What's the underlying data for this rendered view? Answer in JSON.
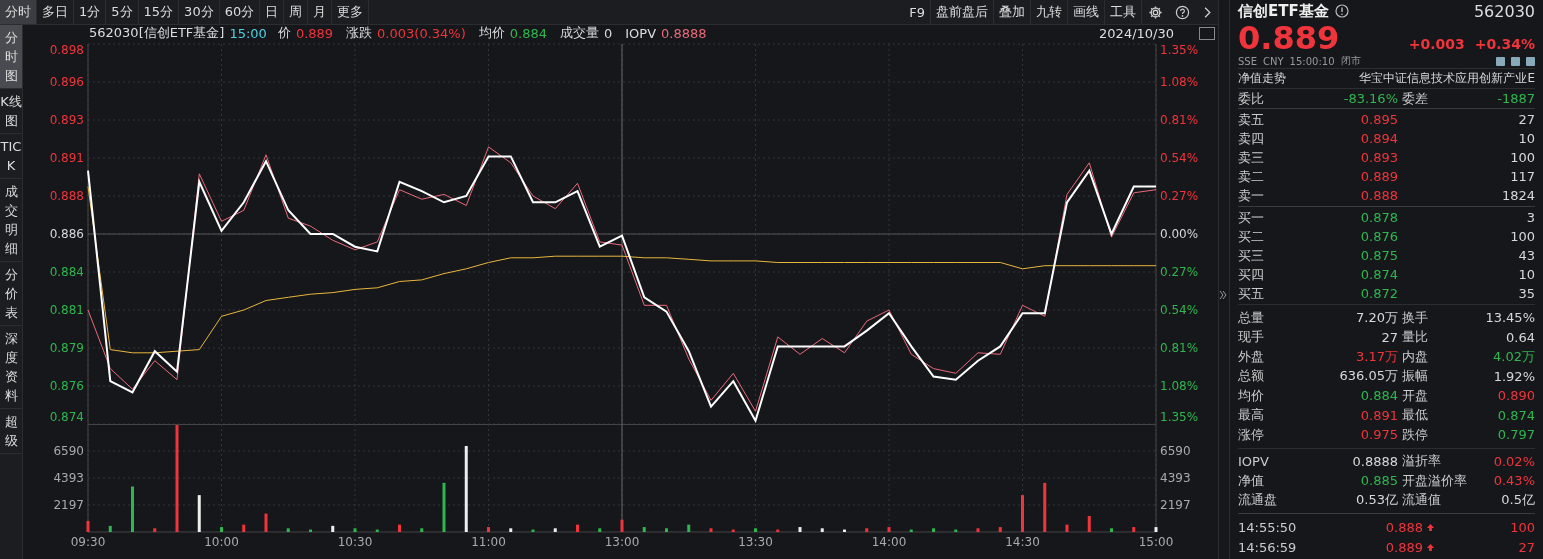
{
  "toolbar": {
    "periods": [
      {
        "label": "分时",
        "selected": true
      },
      {
        "label": "多日",
        "selected": false
      },
      {
        "label": "1分",
        "selected": false
      },
      {
        "label": "5分",
        "selected": false
      },
      {
        "label": "15分",
        "selected": false
      },
      {
        "label": "30分",
        "selected": false
      },
      {
        "label": "60分",
        "selected": false
      },
      {
        "label": "日",
        "selected": false
      },
      {
        "label": "周",
        "selected": false
      },
      {
        "label": "月",
        "selected": false
      },
      {
        "label": "更多",
        "selected": false
      }
    ],
    "tools": [
      "F9",
      "盘前盘后",
      "叠加",
      "九转",
      "画线",
      "工具"
    ]
  },
  "side_tabs": [
    {
      "label": "分时图",
      "selected": true
    },
    {
      "label": "K线图",
      "selected": false
    },
    {
      "label": "TICK",
      "selected": false
    },
    {
      "label": "成交明细",
      "selected": false
    },
    {
      "label": "分价表",
      "selected": false
    },
    {
      "label": "深度资料",
      "selected": false
    },
    {
      "label": "超级",
      "selected": false
    }
  ],
  "chart_header": {
    "code_name": "562030[信创ETF基金]",
    "time": "15:00",
    "fields": [
      {
        "label": "价",
        "value": "0.889",
        "color": "#f0343b"
      },
      {
        "label": "涨跌",
        "value": "0.003(0.34%)",
        "color": "#f0343b"
      },
      {
        "label": "均价",
        "value": "0.884",
        "color": "#2fb64f"
      },
      {
        "label": "成交量",
        "value": "0",
        "color": "#d8d8d8"
      },
      {
        "label": "IOPV",
        "value": "0.8888",
        "color": "#e86a7a"
      }
    ],
    "date": "2024/10/30"
  },
  "price_chart": {
    "chart_data": {
      "type": "line",
      "categories": [
        null,
        null,
        null,
        null,
        null,
        null,
        null,
        null,
        null,
        null,
        null,
        null,
        null,
        null,
        null,
        null,
        null,
        null,
        null,
        null,
        null,
        null,
        null,
        null,
        null,
        null,
        null,
        null,
        null,
        null,
        null,
        null,
        null,
        null,
        null,
        null,
        null,
        null,
        null,
        null,
        null,
        null,
        null,
        null,
        null,
        null,
        null,
        null,
        null
      ],
      "series": [
        {
          "color": "#ffffff",
          "values": [
            0.89,
            0.8767,
            0.876,
            0.8786,
            0.8773,
            0.8893,
            0.8862,
            0.888,
            0.8906,
            0.8875,
            0.886,
            0.886,
            0.8852,
            0.8849,
            0.8893,
            0.8887,
            0.888,
            0.8884,
            0.8909,
            0.8909,
            0.888,
            0.888,
            0.8887,
            0.8852,
            0.8859,
            0.882,
            0.8811,
            0.8786,
            0.8751,
            0.8767,
            0.8742,
            0.8789,
            0.8789,
            0.8789,
            0.8789,
            0.8799,
            0.881,
            0.8789,
            0.877,
            0.8768,
            0.878,
            0.8789,
            0.881,
            0.881,
            0.888,
            0.89,
            0.886,
            0.889,
            0.889
          ]
        },
        {
          "color": "#e8b63c",
          "values": [
            0.889,
            0.8787,
            0.8785,
            0.8785,
            0.8786,
            0.8787,
            0.8808,
            0.8812,
            0.8818,
            0.882,
            0.8822,
            0.8823,
            0.8825,
            0.8826,
            0.883,
            0.8831,
            0.8835,
            0.8838,
            0.8842,
            0.8845,
            0.8845,
            0.8846,
            0.8846,
            0.8846,
            0.8846,
            0.8845,
            0.8845,
            0.8844,
            0.8843,
            0.8843,
            0.8843,
            0.8842,
            0.8842,
            0.8842,
            0.8842,
            0.8842,
            0.8842,
            0.8842,
            0.8842,
            0.8842,
            0.8842,
            0.8842,
            0.8838,
            0.884,
            0.884,
            0.884,
            0.884,
            0.884,
            0.884
          ]
        },
        {
          "color": "#e86a7a",
          "values": [
            0.8812,
            0.8775,
            0.8762,
            0.878,
            0.8768,
            0.8898,
            0.8868,
            0.8875,
            0.891,
            0.887,
            0.8865,
            0.8856,
            0.885,
            0.8855,
            0.8888,
            0.8882,
            0.8885,
            0.8878,
            0.8915,
            0.8905,
            0.8884,
            0.8876,
            0.8892,
            0.8855,
            0.8853,
            0.8815,
            0.8815,
            0.8781,
            0.8755,
            0.8772,
            0.8748,
            0.8795,
            0.8784,
            0.8794,
            0.8785,
            0.8805,
            0.8812,
            0.8784,
            0.8775,
            0.8772,
            0.8785,
            0.8784,
            0.8815,
            0.8808,
            0.8885,
            0.8905,
            0.8858,
            0.8886,
            0.8888
          ]
        }
      ],
      "ylim": [
        0.874,
        0.898
      ],
      "yticks": [
        {
          "value": 0.898,
          "label": "0.898"
        },
        {
          "value": 0.8956,
          "label": "0.896"
        },
        {
          "value": 0.8932,
          "label": "0.893"
        },
        {
          "value": 0.8908,
          "label": "0.891"
        },
        {
          "value": 0.8884,
          "label": "0.888"
        },
        {
          "value": 0.886,
          "label": "0.886"
        },
        {
          "value": 0.8836,
          "label": "0.884"
        },
        {
          "value": 0.8812,
          "label": "0.881"
        },
        {
          "value": 0.8788,
          "label": "0.879"
        },
        {
          "value": 0.8764,
          "label": "0.876"
        },
        {
          "value": 0.874,
          "label": "0.874"
        }
      ],
      "grid": true,
      "ref_lines": [
        {
          "axis": "y",
          "value": 0.886
        }
      ]
    },
    "percent_ticks": [
      {
        "label": "1.35%",
        "color": "#f0343b"
      },
      {
        "label": "1.08%",
        "color": "#f0343b"
      },
      {
        "label": "0.81%",
        "color": "#f0343b"
      },
      {
        "label": "0.54%",
        "color": "#f0343b"
      },
      {
        "label": "0.27%",
        "color": "#f0343b"
      },
      {
        "label": "0.00%",
        "color": "#d8d8d8"
      },
      {
        "label": "0.27%",
        "color": "#2fb64f"
      },
      {
        "label": "0.54%",
        "color": "#2fb64f"
      },
      {
        "label": "0.81%",
        "color": "#2fb64f"
      },
      {
        "label": "1.08%",
        "color": "#2fb64f"
      },
      {
        "label": "1.35%",
        "color": "#2fb64f"
      }
    ]
  },
  "volume_chart": {
    "chart_data": {
      "type": "bar",
      "stacked": true,
      "categories": [
        "09:30",
        null,
        null,
        null,
        null,
        null,
        "10:00",
        null,
        null,
        null,
        null,
        null,
        "10:30",
        null,
        null,
        null,
        null,
        null,
        "11:00",
        null,
        null,
        null,
        null,
        null,
        "13:00",
        null,
        null,
        null,
        null,
        null,
        "13:30",
        null,
        null,
        null,
        null,
        null,
        "14:00",
        null,
        null,
        null,
        null,
        null,
        "14:30",
        null,
        null,
        null,
        null,
        null,
        "15:00"
      ],
      "series": [
        {
          "color": "#f0343b",
          "values": [
            900,
            null,
            null,
            300,
            8700,
            null,
            null,
            600,
            1500,
            null,
            null,
            null,
            null,
            null,
            600,
            null,
            null,
            null,
            400,
            null,
            null,
            null,
            600,
            null,
            1000,
            null,
            null,
            null,
            300,
            200,
            null,
            200,
            null,
            null,
            null,
            300,
            400,
            null,
            null,
            null,
            300,
            400,
            3000,
            4000,
            600,
            1300,
            null,
            400,
            null
          ]
        },
        {
          "color": "#2fb64f",
          "values": [
            null,
            500,
            3700,
            null,
            null,
            null,
            400,
            null,
            null,
            300,
            200,
            null,
            300,
            200,
            null,
            300,
            4000,
            null,
            null,
            null,
            200,
            null,
            null,
            300,
            null,
            400,
            300,
            600,
            null,
            null,
            300,
            null,
            null,
            null,
            null,
            null,
            null,
            200,
            300,
            200,
            null,
            null,
            null,
            null,
            null,
            null,
            300,
            null,
            null
          ]
        },
        {
          "color": "#eeeeee",
          "values": [
            null,
            null,
            null,
            null,
            null,
            3000,
            null,
            null,
            null,
            null,
            null,
            500,
            null,
            null,
            null,
            null,
            null,
            7000,
            null,
            300,
            null,
            300,
            null,
            null,
            null,
            null,
            null,
            null,
            null,
            null,
            null,
            null,
            400,
            300,
            200,
            null,
            null,
            null,
            null,
            null,
            null,
            null,
            null,
            null,
            null,
            null,
            null,
            null,
            400
          ]
        }
      ],
      "ylim": [
        0,
        8787
      ],
      "yticks": [
        2197,
        4393,
        6590
      ],
      "grid": true
    },
    "right_axis_labels": [
      "6590",
      "4393",
      "2197"
    ]
  },
  "quote": {
    "name": "信创ETF基金",
    "code": "562030",
    "price": "0.889",
    "change": "+0.003",
    "change_pct": "+0.34%",
    "color": "#f0343b",
    "exchange": "SSE",
    "currency": "CNY",
    "time": "15:00:10",
    "status": "闭市"
  },
  "nav_row": {
    "tab": "净值走势",
    "index_name": "华宝中证信息技术应用创新产业E"
  },
  "ratio_row": [
    {
      "label": "委比",
      "value": "-83.16%",
      "color": "#2fb64f"
    },
    {
      "label": "委差",
      "value": "-1887",
      "color": "#2fb64f"
    }
  ],
  "asks": [
    {
      "label": "卖五",
      "price": "0.895",
      "volume": "27",
      "color": "#f0343b"
    },
    {
      "label": "卖四",
      "price": "0.894",
      "volume": "10",
      "color": "#f0343b"
    },
    {
      "label": "卖三",
      "price": "0.893",
      "volume": "100",
      "color": "#f0343b"
    },
    {
      "label": "卖二",
      "price": "0.889",
      "volume": "117",
      "color": "#f0343b"
    },
    {
      "label": "卖一",
      "price": "0.888",
      "volume": "1824",
      "color": "#f0343b"
    }
  ],
  "bids": [
    {
      "label": "买一",
      "price": "0.878",
      "volume": "3",
      "color": "#2fb64f"
    },
    {
      "label": "买二",
      "price": "0.876",
      "volume": "100",
      "color": "#2fb64f"
    },
    {
      "label": "买三",
      "price": "0.875",
      "volume": "43",
      "color": "#2fb64f"
    },
    {
      "label": "买四",
      "price": "0.874",
      "volume": "10",
      "color": "#2fb64f"
    },
    {
      "label": "买五",
      "price": "0.872",
      "volume": "35",
      "color": "#2fb64f"
    }
  ],
  "stats": [
    [
      {
        "label": "总量",
        "value": "7.20万",
        "color": "#d8d8d8"
      },
      {
        "label": "换手",
        "value": "13.45%",
        "color": "#d8d8d8"
      }
    ],
    [
      {
        "label": "现手",
        "value": "27",
        "color": "#d8d8d8"
      },
      {
        "label": "量比",
        "value": "0.64",
        "color": "#d8d8d8"
      }
    ],
    [
      {
        "label": "外盘",
        "value": "3.17万",
        "color": "#f0343b"
      },
      {
        "label": "内盘",
        "value": "4.02万",
        "color": "#2fb64f"
      }
    ],
    [
      {
        "label": "总额",
        "value": "636.05万",
        "color": "#d8d8d8"
      },
      {
        "label": "振幅",
        "value": "1.92%",
        "color": "#d8d8d8"
      }
    ],
    [
      {
        "label": "均价",
        "value": "0.884",
        "color": "#2fb64f"
      },
      {
        "label": "开盘",
        "value": "0.890",
        "color": "#f0343b"
      }
    ],
    [
      {
        "label": "最高",
        "value": "0.891",
        "color": "#f0343b"
      },
      {
        "label": "最低",
        "value": "0.874",
        "color": "#2fb64f"
      }
    ],
    [
      {
        "label": "涨停",
        "value": "0.975",
        "color": "#f0343b"
      },
      {
        "label": "跌停",
        "value": "0.797",
        "color": "#2fb64f"
      }
    ]
  ],
  "fund_stats": [
    [
      {
        "label": "IOPV",
        "value": "0.8888",
        "color": "#d8d8d8"
      },
      {
        "label": "溢折率",
        "value": "0.02%",
        "color": "#f0343b"
      }
    ],
    [
      {
        "label": "净值",
        "value": "0.885",
        "color": "#2fb64f"
      },
      {
        "label": "开盘溢价率",
        "value": "0.43%",
        "color": "#f0343b"
      }
    ],
    [
      {
        "label": "流通盘",
        "value": "0.53亿",
        "color": "#d8d8d8"
      },
      {
        "label": "流通值",
        "value": "0.5亿",
        "color": "#d8d8d8"
      }
    ]
  ],
  "trades": [
    {
      "time": "14:55:50",
      "price": "0.888",
      "up_tick": true,
      "volume": "100",
      "color": "#f0343b"
    },
    {
      "time": "14:56:59",
      "price": "0.889",
      "up_tick": true,
      "volume": "27",
      "color": "#f0343b"
    }
  ]
}
